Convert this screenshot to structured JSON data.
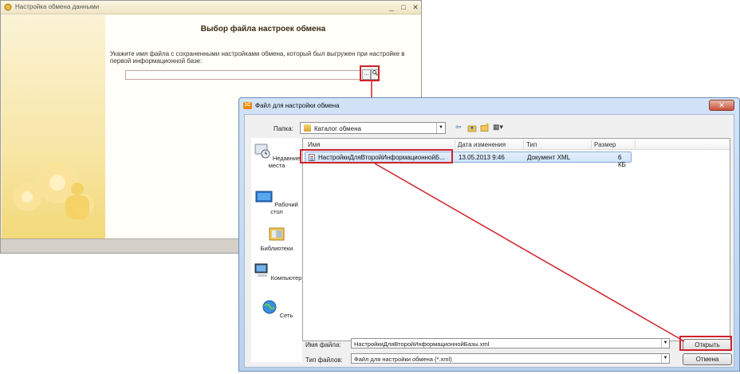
{
  "bg_window": {
    "title": "Настройка обмена данными",
    "window_controls": [
      "_",
      "□",
      "✕"
    ],
    "heading": "Выбор файла настроек обмена",
    "instruction": "Укажите имя файла с сохраненными настройками обмена, который был выгружен при настройке в первой информационной базе:",
    "path_value": "",
    "browse_label": "...",
    "search_icon": "magnifier-icon"
  },
  "dialog": {
    "title": "Файл для настройки обмена",
    "app_icon_text": "1C",
    "close_label": "✕",
    "look_in_label": "Папка:",
    "look_in_value": "Каталог обмена",
    "toolbar": {
      "back_icon": "back-arrow-icon",
      "up_icon": "folder-up-icon",
      "new_folder_icon": "new-folder-icon",
      "views_icon": "view-menu-icon",
      "back_glyph": "⇦",
      "views_glyph": "▦▾"
    },
    "places": [
      {
        "label": "Недавние места",
        "icon": "recent-places-icon"
      },
      {
        "label": "Рабочий стол",
        "icon": "desktop-icon"
      },
      {
        "label": "Библиотеки",
        "icon": "libraries-icon"
      },
      {
        "label": "Компьютер",
        "icon": "computer-icon"
      },
      {
        "label": "Сеть",
        "icon": "network-icon"
      }
    ],
    "columns": [
      "Имя",
      "Дата изменения",
      "Тип",
      "Размер"
    ],
    "files": [
      {
        "name": "НастройкиДляВторойИнформационнойБ...",
        "date": "13.05.2013 9:46",
        "type": "Документ XML",
        "size": "6 КБ"
      }
    ],
    "filename_label": "Имя файла:",
    "filename_value": "НастройкиДляВторойИнформационнойБазы.xml",
    "filetype_label": "Тип файлов:",
    "filetype_value": "Файл для настройки обмена (*.xml)",
    "open_label": "Открыть",
    "cancel_label": "Отмена"
  },
  "colors": {
    "highlight": "#d0212a",
    "dialog_frame": "#b9d2ee",
    "selection": "#cfe4fa",
    "onec_sidebar": "#f3d97a"
  }
}
